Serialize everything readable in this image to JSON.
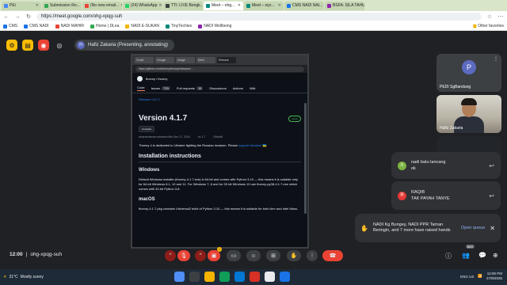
{
  "browser": {
    "tabs": [
      {
        "label": "PEi",
        "color": "#4285f4",
        "active": false
      },
      {
        "label": "Submission Ro...",
        "color": "#34a853",
        "active": false
      },
      {
        "label": "(No new email...",
        "color": "#ea4335",
        "active": false
      },
      {
        "label": "(24) WhatsApp",
        "color": "#25d366",
        "active": false
      },
      {
        "label": "TTI: LIVE Bengk...",
        "color": "#3c4043",
        "active": false
      },
      {
        "label": "Meet – ohg...",
        "color": "#00897b",
        "active": true
      },
      {
        "label": "Meet – wyr...",
        "color": "#00897b",
        "active": false
      },
      {
        "label": "CMS NADI NAI...",
        "color": "#1a73e8",
        "active": false
      },
      {
        "label": "BSFA: SILA TAHU...",
        "color": "#8e24aa",
        "active": false
      }
    ],
    "url": "https://meet.google.com/ohg-xpqg-suh",
    "bookmarks": [
      "CMS",
      "CMS NADI",
      "NADI MAHIR",
      "Home | DLea",
      "NADI E-SUKAN",
      "TinyTechies",
      "NADI Wellbeing"
    ],
    "other_favorites": "Other favorites"
  },
  "meet": {
    "presenter_initial": "H",
    "presenter_label": "Hafiz Zakaria (Presenting, annotating)",
    "meeting_time": "12:00",
    "meeting_code": "ohg-xpqg-suh",
    "participant_count": "643",
    "raised_hand_badge": "1"
  },
  "shared_screen": {
    "tabs": [
      "Gmail",
      "Google",
      "Image",
      "Meet",
      "Release"
    ],
    "url": "https://github.com/thonny/thonny/releases/...",
    "repo": "thonny / thonny",
    "nav": [
      {
        "label": "Code",
        "count": ""
      },
      {
        "label": "Issues",
        "count": "733"
      },
      {
        "label": "Pull requests",
        "count": "15"
      },
      {
        "label": "Discussions",
        "count": ""
      },
      {
        "label": "Actions",
        "count": ""
      },
      {
        "label": "Wiki",
        "count": ""
      }
    ],
    "breadcrumb": "Releases / v4.1.7",
    "release_title": "Version 4.1.7",
    "latest_badge": "Latest",
    "compare_label": "Compare",
    "meta_author": "aivarannamaa released this Dec 17, 2024",
    "meta_tag": "v4.1.7",
    "meta_commit": "f2eba6f",
    "ukraine_text_pre": "Thonny 4 is dedicated to Ukraine fighting the Russian invasion. Please ",
    "ukraine_link": "support Ukraine!",
    "ukraine_flag": "🇺🇦",
    "heading_install": "Installation instructions",
    "heading_windows": "Windows",
    "windows_text": "Default Windows installer (thonny-4.1.7.exe) is 64-bit and comes with Python 3.10 — this means it is suitable only for 64-bit Windows 8.1, 10 and 11. For Windows 7, 8 and for 32-bit Windows 10 use thonny-py38-4.1.7.exe which comes with 32-bit Python 3.8.",
    "heading_macos": "macOS",
    "macos_text": "thonny-4.1.7.pkg contains Universal2 build of Python 3.10 — this means it is suitable for both Arm and Intel Macs."
  },
  "participants": [
    {
      "name": "PEDI SgBandung",
      "initial": "P",
      "color": "#5c6bc0"
    },
    {
      "name": "Hafiz Zakaria"
    }
  ],
  "chat": [
    {
      "initial": "n",
      "color": "#7cb342",
      "name": "nadi batu lancang",
      "message": "ok"
    },
    {
      "initial": "R",
      "color": "#e53935",
      "name": "RAQIB",
      "message": "TAK PAYAH TANYE"
    }
  ],
  "raised_hands": {
    "text": "NADI Kg Bungey, NADI PPR Taman Beringin, and 7 more have raised hands",
    "action": "Open queue"
  },
  "taskbar": {
    "temperature": "31°C",
    "weather": "Mostly sunny",
    "language": "ENG US",
    "time": "12:00 PM",
    "date": "27/8/2025"
  }
}
